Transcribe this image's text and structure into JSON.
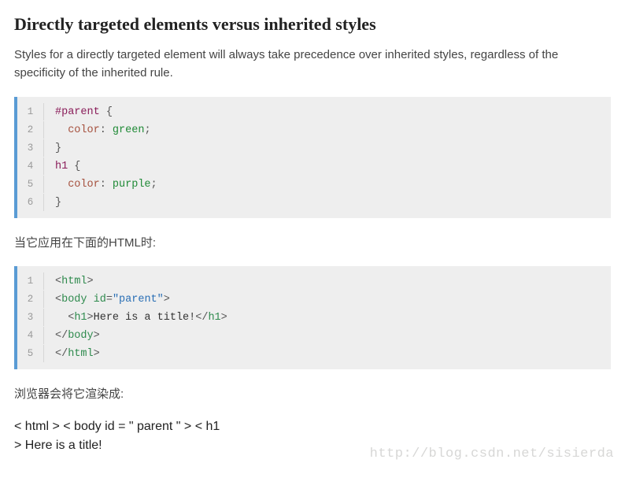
{
  "heading": "Directly targeted elements versus inherited styles",
  "intro": "Styles for a directly targeted element will always take precedence over inherited styles, regardless of the specificity of the inherited rule.",
  "code1": {
    "lines": [
      {
        "n": "1",
        "tokens": [
          {
            "t": "#parent",
            "c": "selector"
          },
          {
            "t": " {",
            "c": "punct"
          }
        ]
      },
      {
        "n": "2",
        "tokens": [
          {
            "t": "  ",
            "c": "text"
          },
          {
            "t": "color",
            "c": "prop"
          },
          {
            "t": ": ",
            "c": "punct"
          },
          {
            "t": "green",
            "c": "value"
          },
          {
            "t": ";",
            "c": "punct"
          }
        ]
      },
      {
        "n": "3",
        "tokens": [
          {
            "t": "}",
            "c": "punct"
          }
        ]
      },
      {
        "n": "4",
        "tokens": [
          {
            "t": "h1",
            "c": "selector"
          },
          {
            "t": " {",
            "c": "punct"
          }
        ]
      },
      {
        "n": "5",
        "tokens": [
          {
            "t": "  ",
            "c": "text"
          },
          {
            "t": "color",
            "c": "prop"
          },
          {
            "t": ": ",
            "c": "punct"
          },
          {
            "t": "purple",
            "c": "value"
          },
          {
            "t": ";",
            "c": "punct"
          }
        ]
      },
      {
        "n": "6",
        "tokens": [
          {
            "t": "}",
            "c": "punct"
          }
        ]
      }
    ]
  },
  "midtext1": "当它应用在下面的HTML时:",
  "code2": {
    "lines": [
      {
        "n": "1",
        "tokens": [
          {
            "t": "<",
            "c": "punct"
          },
          {
            "t": "html",
            "c": "tag"
          },
          {
            "t": ">",
            "c": "punct"
          }
        ]
      },
      {
        "n": "2",
        "tokens": [
          {
            "t": "<",
            "c": "punct"
          },
          {
            "t": "body",
            "c": "tag"
          },
          {
            "t": " ",
            "c": "text"
          },
          {
            "t": "id",
            "c": "attrname"
          },
          {
            "t": "=",
            "c": "punct"
          },
          {
            "t": "\"parent\"",
            "c": "attrval"
          },
          {
            "t": ">",
            "c": "punct"
          }
        ]
      },
      {
        "n": "3",
        "tokens": [
          {
            "t": "  ",
            "c": "text"
          },
          {
            "t": "<",
            "c": "punct"
          },
          {
            "t": "h1",
            "c": "tag"
          },
          {
            "t": ">",
            "c": "punct"
          },
          {
            "t": "Here is a title!",
            "c": "text"
          },
          {
            "t": "</",
            "c": "punct"
          },
          {
            "t": "h1",
            "c": "tag"
          },
          {
            "t": ">",
            "c": "punct"
          }
        ]
      },
      {
        "n": "4",
        "tokens": [
          {
            "t": "</",
            "c": "punct"
          },
          {
            "t": "body",
            "c": "tag"
          },
          {
            "t": ">",
            "c": "punct"
          }
        ]
      },
      {
        "n": "5",
        "tokens": [
          {
            "t": "</",
            "c": "punct"
          },
          {
            "t": "html",
            "c": "tag"
          },
          {
            "t": ">",
            "c": "punct"
          }
        ]
      }
    ]
  },
  "midtext2": "浏览器会将它渲染成:",
  "rendered": {
    "line1": "< html > < body id = \" parent \" > < h1",
    "line2": "> Here is a title!"
  },
  "watermark": "http://blog.csdn.net/sisierda"
}
